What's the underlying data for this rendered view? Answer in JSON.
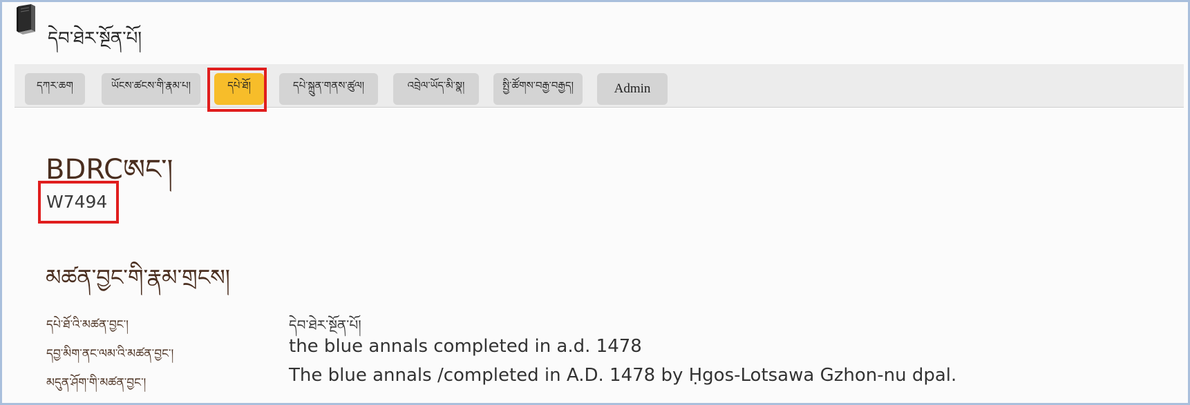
{
  "header": {
    "logo_icon": "book-icon",
    "site_title": "དེབ་ཐེར་སྔོན་པོ།"
  },
  "nav": {
    "tabs": [
      {
        "label": "དཀར་ཆག"
      },
      {
        "label": "ཡོངས་ཚངས་གི་རྣམ་པ།"
      },
      {
        "label": "དཔེ་ཐོ།"
      },
      {
        "label": "དཔེ་སྐྲུན་གནས་ཚུལ།"
      },
      {
        "label": "འབྲེལ་ཡོད་མི་སྣ།"
      },
      {
        "label": "སྤྱི་ཚོགས་བརྒྱ་བརྒྱད།"
      },
      {
        "label": "Admin"
      }
    ],
    "active_index": 2
  },
  "main": {
    "heading": "BDRCཨང་།",
    "resource_id": "W7494",
    "titles_heading": "མཚན་བྱང་གི་རྣམ་གྲངས།",
    "titles": [
      {
        "label": "དཔེ་ཐོ་འི་མཚན་བྱང་།",
        "value": "དེབ་ཐེར་སྔོན་པོ།"
      },
      {
        "label": "དབྱ་མིག་ནང་ལམ་འི་མཚན་བྱང་།",
        "value": "the blue annals completed in a.d. 1478"
      },
      {
        "label": "མདུན་ཤོག་གི་མཚན་བྱང་།",
        "value": "The blue annals /completed in A.D. 1478 by Ḥgos-Lotsawa Gzhon-nu dpal."
      }
    ]
  },
  "colors": {
    "active_tab": "#f7bd2a",
    "tab": "#d4d4d4",
    "highlight": "#e01e1e",
    "heading": "#4a2e1f"
  }
}
